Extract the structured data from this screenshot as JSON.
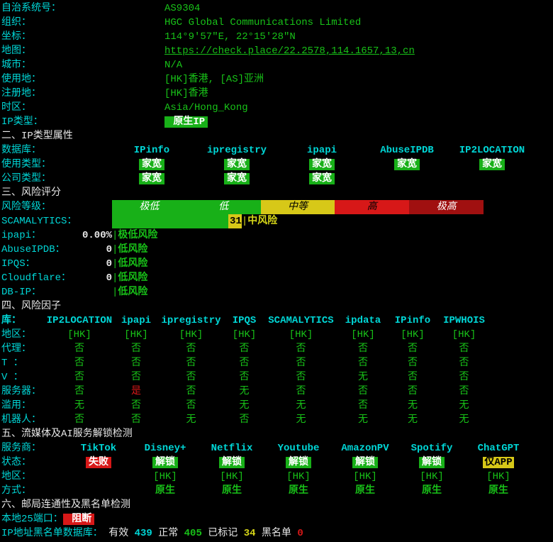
{
  "info": {
    "asn_label": "自治系统号：",
    "asn": "AS9304",
    "org_label": "组织：",
    "org": "HGC Global Communications Limited",
    "coord_label": "坐标：",
    "coord": "114°9′57″E, 22°15′28″N",
    "map_label": "地图：",
    "map_url": "https://check.place/22.2578,114.1657,13,cn",
    "city_label": "城市：",
    "city": "N/A",
    "usage_label": "使用地：",
    "usage": "[HK]香港, [AS]亚洲",
    "reg_label": "注册地：",
    "reg": "[HK]香港",
    "tz_label": "时区：",
    "tz": "Asia/Hong_Kong",
    "iptype_label": "IP类型：",
    "iptype": " 原生IP "
  },
  "sec2": "二、IP类型属性",
  "iptype": {
    "db_label": "数据库：",
    "usage_label": "使用类型：",
    "company_label": "公司类型：",
    "val": " 家宽 ",
    "headers": [
      "IPinfo",
      "ipregistry",
      "ipapi",
      "AbuseIPDB",
      "IP2LOCATION"
    ]
  },
  "sec3": "三、风险评分",
  "risk": {
    "level_label": "风险等级：",
    "levels": [
      "极低",
      "低",
      "中等",
      "高",
      "极高"
    ],
    "scamalytics_label": "SCAMALYTICS：",
    "scamalytics_score": "31",
    "scamalytics_text": "中风险",
    "ipapi_label": "ipapi：",
    "ipapi_score": "0.00%",
    "ipapi_text": "极低风险",
    "abuse_label": "AbuseIPDB：",
    "abuse_score": "0",
    "abuse_text": "低风险",
    "ipqs_label": "IPQS：",
    "ipqs_score": "0",
    "ipqs_text": "低风险",
    "cf_label": "Cloudflare：",
    "cf_score": "0",
    "cf_text": "低风险",
    "dbip_label": "DB-IP：",
    "dbip_text": "低风险"
  },
  "sec4": "四、风险因子",
  "factor": {
    "header_label": "库：",
    "headers": [
      "IP2LOCATION",
      "ipapi",
      "ipregistry",
      "IPQS",
      "SCAMALYTICS",
      "ipdata",
      "IPinfo",
      "IPWHOIS"
    ],
    "rows": [
      {
        "label": "地区：",
        "v": [
          "[HK]",
          "[HK]",
          "[HK]",
          "[HK]",
          "[HK]",
          "[HK]",
          "[HK]",
          "[HK]"
        ],
        "colors": [
          "g",
          "g",
          "g",
          "g",
          "g",
          "g",
          "g",
          "g"
        ]
      },
      {
        "label": "代理：",
        "v": [
          "否",
          "否",
          "否",
          "否",
          "否",
          "否",
          "否",
          "否"
        ],
        "colors": [
          "g",
          "g",
          "g",
          "g",
          "g",
          "g",
          "g",
          "g"
        ]
      },
      {
        "label": "T ：",
        "v": [
          "否",
          "否",
          "否",
          "否",
          "否",
          "否",
          "否",
          "否"
        ],
        "colors": [
          "g",
          "g",
          "g",
          "g",
          "g",
          "g",
          "g",
          "g"
        ]
      },
      {
        "label": "V ：",
        "v": [
          "否",
          "否",
          "否",
          "否",
          "否",
          "无",
          "否",
          "否"
        ],
        "colors": [
          "g",
          "g",
          "g",
          "g",
          "g",
          "g",
          "g",
          "g"
        ]
      },
      {
        "label": "服务器：",
        "v": [
          "否",
          "是",
          "否",
          "无",
          "否",
          "否",
          "否",
          "否"
        ],
        "colors": [
          "g",
          "r",
          "g",
          "g",
          "g",
          "g",
          "g",
          "g"
        ]
      },
      {
        "label": "滥用：",
        "v": [
          "无",
          "否",
          "否",
          "无",
          "无",
          "否",
          "无",
          "无"
        ],
        "colors": [
          "g",
          "g",
          "g",
          "g",
          "g",
          "g",
          "g",
          "g"
        ]
      },
      {
        "label": "机器人：",
        "v": [
          "否",
          "否",
          "无",
          "否",
          "无",
          "无",
          "无",
          "无"
        ],
        "colors": [
          "g",
          "g",
          "g",
          "g",
          "g",
          "g",
          "g",
          "g"
        ]
      }
    ]
  },
  "sec5": "五、流媒体及AI服务解锁检测",
  "stream": {
    "provider_label": "服务商：",
    "providers": [
      "TikTok",
      "Disney+",
      "Netflix",
      "Youtube",
      "AmazonPV",
      "Spotify",
      "ChatGPT"
    ],
    "status_label": "状态：",
    "status": [
      {
        "text": " 失败 ",
        "cls": "bg-red"
      },
      {
        "text": " 解锁 ",
        "cls": "bg-green"
      },
      {
        "text": " 解锁 ",
        "cls": "bg-green"
      },
      {
        "text": " 解锁 ",
        "cls": "bg-green"
      },
      {
        "text": " 解锁 ",
        "cls": "bg-green"
      },
      {
        "text": " 解锁 ",
        "cls": "bg-green"
      },
      {
        "text": " 仅APP ",
        "cls": "bg-yellow"
      }
    ],
    "region_label": "地区：",
    "region": [
      "",
      "[HK]",
      "[HK]",
      "[HK]",
      "[HK]",
      "[HK]",
      "[HK]"
    ],
    "method_label": "方式：",
    "method": [
      "",
      "原生",
      "原生",
      "原生",
      "原生",
      "原生",
      "原生"
    ]
  },
  "sec6": "六、邮局连通性及黑名单检测",
  "mail": {
    "port_label": "本地25端口：",
    "port_status": " 阻断 ",
    "bl_label": "IP地址黑名单数据库：",
    "valid_label": "  有效 ",
    "valid": "439",
    "normal_label": "   正常 ",
    "normal": "405",
    "marked_label": "   已标记 ",
    "marked": "34",
    "black_label": "   黑名单 ",
    "black": "0"
  }
}
